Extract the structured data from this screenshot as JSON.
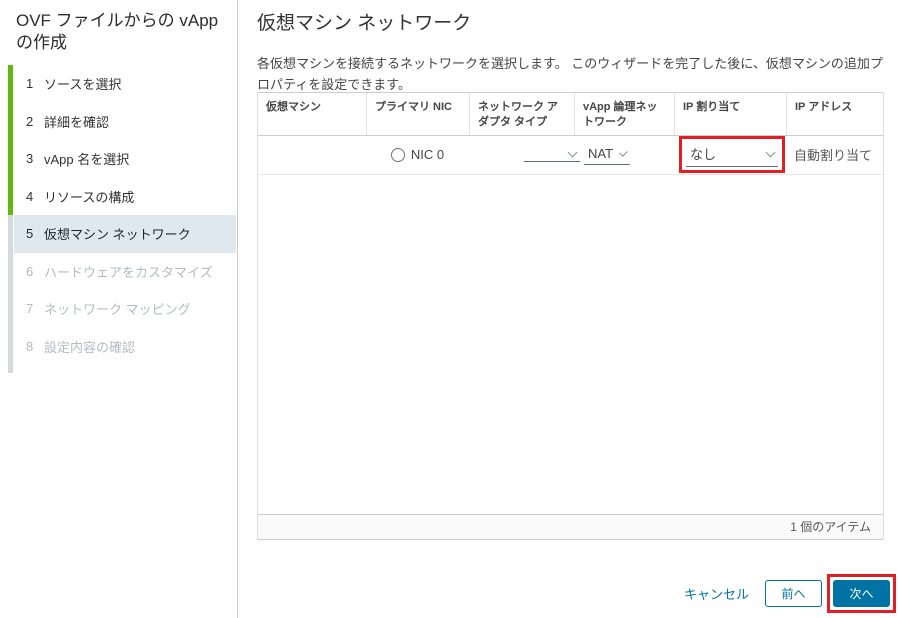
{
  "wizard": {
    "title": "OVF ファイルからの vApp の作成",
    "steps": [
      {
        "num": "1",
        "label": "ソースを選択",
        "state": "done"
      },
      {
        "num": "2",
        "label": "詳細を確認",
        "state": "done"
      },
      {
        "num": "3",
        "label": "vApp 名を選択",
        "state": "done"
      },
      {
        "num": "4",
        "label": "リソースの構成",
        "state": "done"
      },
      {
        "num": "5",
        "label": "仮想マシン ネットワーク",
        "state": "current"
      },
      {
        "num": "6",
        "label": "ハードウェアをカスタマイズ",
        "state": "upcoming"
      },
      {
        "num": "7",
        "label": "ネットワーク マッピング",
        "state": "upcoming"
      },
      {
        "num": "8",
        "label": "設定内容の確認",
        "state": "upcoming"
      }
    ]
  },
  "main": {
    "title": "仮想マシン ネットワーク",
    "description": "各仮想マシンを接続するネットワークを選択します。 このウィザードを完了した後に、仮想マシンの追加プロパティを設定できます。",
    "table": {
      "columns": [
        "仮想マシン",
        "プライマリ NIC",
        "ネットワーク アダプタ タイプ",
        "vApp 論理ネットワーク",
        "IP 割り当て",
        "IP アドレス"
      ],
      "row": {
        "vm_name": "",
        "primary_nic_label": "NIC 0",
        "adapter_type_value": "",
        "vapp_network_value": "NAT",
        "ip_mode_value": "なし",
        "ip_address_value": "自動割り当て"
      },
      "footer_count": "1 個のアイテム"
    },
    "buttons": {
      "cancel": "キャンセル",
      "back": "前へ",
      "next": "次へ"
    }
  },
  "colors": {
    "accent_blue": "#0072a3",
    "progress_green": "#61b715",
    "annotation_red": "#e12026",
    "current_step_bg": "#dfe8ee"
  }
}
